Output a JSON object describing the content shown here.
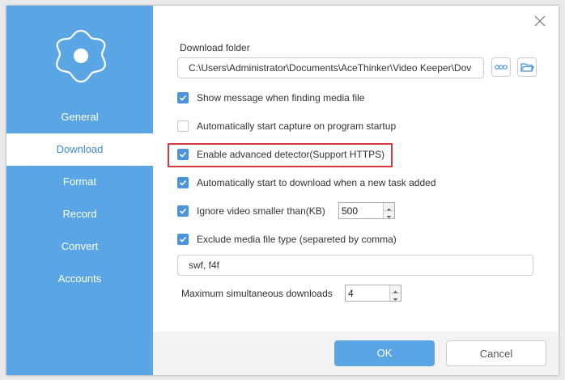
{
  "sidebar": {
    "items": [
      {
        "label": "General"
      },
      {
        "label": "Download"
      },
      {
        "label": "Format"
      },
      {
        "label": "Record"
      },
      {
        "label": "Convert"
      },
      {
        "label": "Accounts"
      }
    ],
    "active": "Download"
  },
  "download": {
    "folder_label": "Download folder",
    "folder_path": "C:\\Users\\Administrator\\Documents\\AceThinker\\Video Keeper\\Dov",
    "options": [
      {
        "label": "Show message when finding media file",
        "checked": true
      },
      {
        "label": "Automatically start capture on program startup",
        "checked": false
      },
      {
        "label": "Enable advanced detector(Support HTTPS)",
        "checked": true
      },
      {
        "label": "Automatically start to download when a new task added",
        "checked": true
      },
      {
        "label": "Ignore video smaller than(KB)",
        "checked": true
      },
      {
        "label": "Exclude media file type (separeted by comma)",
        "checked": true
      }
    ],
    "ignore_size_value": "500",
    "exclude_types": "swf, f4f",
    "max_downloads_label": "Maximum simultaneous downloads",
    "max_downloads_value": "4"
  },
  "footer": {
    "ok_label": "OK",
    "cancel_label": "Cancel"
  },
  "colors": {
    "accent": "#5aa6e4",
    "highlight": "#d63a3a"
  }
}
